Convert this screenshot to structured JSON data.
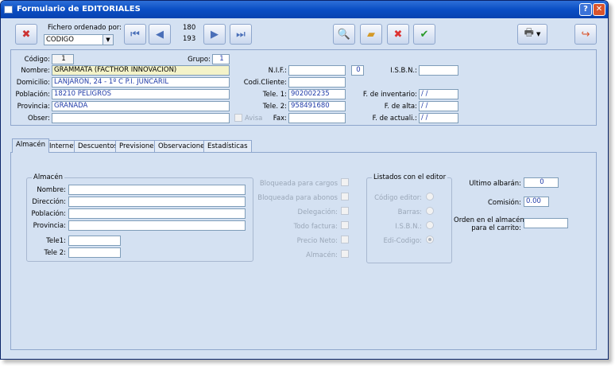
{
  "window": {
    "title": "Formulario de EDITORIALES",
    "help_label": "?",
    "close_label": "✕"
  },
  "toolbar": {
    "sort_label": "Fichero ordenado por:",
    "sort_value": "CODIGO",
    "record_current": "180",
    "record_total": "193"
  },
  "record": {
    "codigo_label": "Código:",
    "codigo": "1",
    "grupo_label": "Grupo:",
    "grupo": "1",
    "nombre_label": "Nombre:",
    "nombre": "GRAMMATA (FACTHOR INNOVACION)",
    "domicilio_label": "Domicilio:",
    "domicilio": "LANJARON, 24 - 1º C   P.I. JUNCARIL",
    "poblacion_label": "Población:",
    "poblacion": "18210 PELIGROS",
    "provincia_label": "Provincia:",
    "provincia": "GRANADA",
    "obser_label": "Obser:",
    "obser": "",
    "avisa_label": "Avisa",
    "nif_label": "N.I.F.:",
    "nif": "",
    "nif_extra": "0",
    "codcliente_label": "Codi.Cliente:",
    "codcliente": "",
    "tele1_label": "Tele. 1:",
    "tele1": "902002235",
    "tele2_label": "Tele. 2:",
    "tele2": "958491680",
    "fax_label": "Fax:",
    "fax": "",
    "isbn_label": "I.S.B.N.:",
    "isbn": "",
    "finventario_label": "F. de inventario:",
    "finventario": " / /",
    "falta_label": "F. de alta:",
    "falta": " / /",
    "factual_label": "F. de actuali.:",
    "factual": " / /"
  },
  "tabs": [
    "Almacén",
    "Internet",
    "Descuentos",
    "Previsiones",
    "Observaciones",
    "Estadísticas"
  ],
  "almacen": {
    "group_label": "Almacén",
    "nombre_label": "Nombre:",
    "direccion_label": "Dirección:",
    "poblacion_label": "Población:",
    "provincia_label": "Provincia:",
    "tele1_label": "Tele1:",
    "tele2_label": "Tele 2:",
    "checks": [
      "Bloqueada para cargos",
      "Bloqueada para abonos",
      "Delegación:",
      "Todo factura:",
      "Precio Neto:",
      "Almacén:"
    ],
    "listados_label": "Listados con el editor",
    "radios": [
      "Código editor:",
      "Barras:",
      "I.S.B.N.:",
      "Edi-Codigo:"
    ],
    "ultimo_label": "Ultimo albarán:",
    "ultimo": "0",
    "comision_label": "Comisión:",
    "comision": "0.00",
    "orden_label1": "Orden en el almacén",
    "orden_label2": "para el carrito:",
    "orden": ""
  }
}
